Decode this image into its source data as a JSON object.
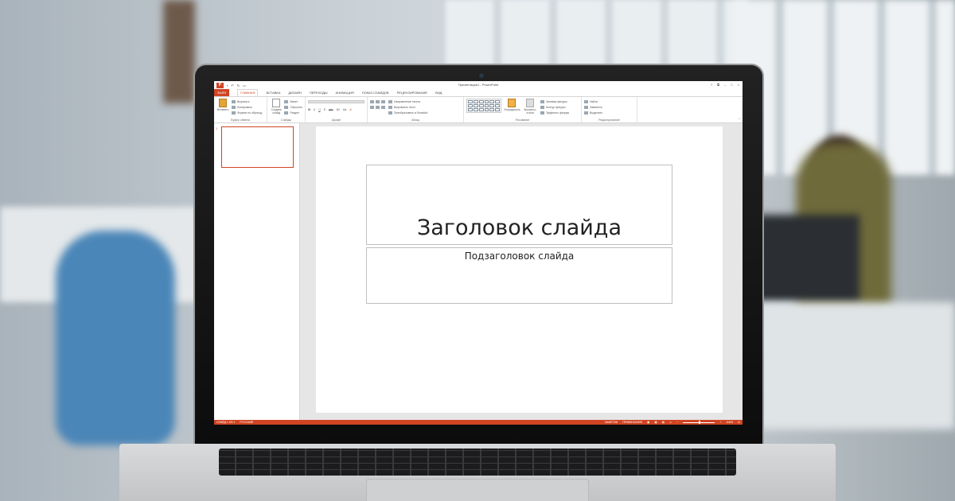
{
  "window": {
    "title": "Презентация1 - PowerPoint",
    "controls": [
      "?",
      "⧉",
      "–",
      "□",
      "×"
    ]
  },
  "quick_access": [
    "save-icon",
    "undo-icon",
    "redo-icon",
    "presenter-icon"
  ],
  "tabs": [
    {
      "label": "ФАЙЛ"
    },
    {
      "label": "ГЛАВНАЯ"
    },
    {
      "label": "ВСТАВКА"
    },
    {
      "label": "ДИЗАЙН"
    },
    {
      "label": "ПЕРЕХОДЫ"
    },
    {
      "label": "АНИМАЦИЯ"
    },
    {
      "label": "ПОКАЗ СЛАЙДОВ"
    },
    {
      "label": "РЕЦЕНЗИРОВАНИЕ"
    },
    {
      "label": "ВИД"
    }
  ],
  "ribbon": {
    "clipboard": {
      "paste": "Вставить",
      "cut": "Вырезать",
      "copy": "Копировать",
      "format_painter": "Формат по образцу",
      "label": "Буфер обмена"
    },
    "slides": {
      "new_slide": "Создать слайд",
      "layout": "Макет",
      "reset": "Сбросить",
      "section": "Раздел",
      "label": "Слайды"
    },
    "font": {
      "label": "Шрифт",
      "buttons": [
        "Ж",
        "К",
        "Ч",
        "S",
        "abc",
        "AV",
        "Аа",
        "А"
      ]
    },
    "paragraph": {
      "text_direction": "Направление текста",
      "align_text": "Выровнять текст",
      "smartart": "Преобразовать в SmartArt",
      "label": "Абзац"
    },
    "drawing": {
      "arrange": "Упорядочить",
      "quick_styles": "Экспресс-стили",
      "shape_fill": "Заливка фигуры",
      "shape_outline": "Контур фигуры",
      "shape_effects": "Эффекты фигуры",
      "label": "Рисование"
    },
    "editing": {
      "find": "Найти",
      "replace": "Заменить",
      "select": "Выделить",
      "label": "Редактирование"
    }
  },
  "thumbnails": [
    {
      "number": "1"
    }
  ],
  "slide": {
    "title": "Заголовок слайда",
    "subtitle": "Подзаголовок слайда"
  },
  "status": {
    "slide_info": "СЛАЙД 1 ИЗ 1",
    "language": "РУССКИЙ",
    "notes": "ЗАМЕТКИ",
    "comments": "ПРИМЕЧАНИЯ",
    "zoom": "116%"
  },
  "colors": {
    "accent": "#D04423"
  }
}
